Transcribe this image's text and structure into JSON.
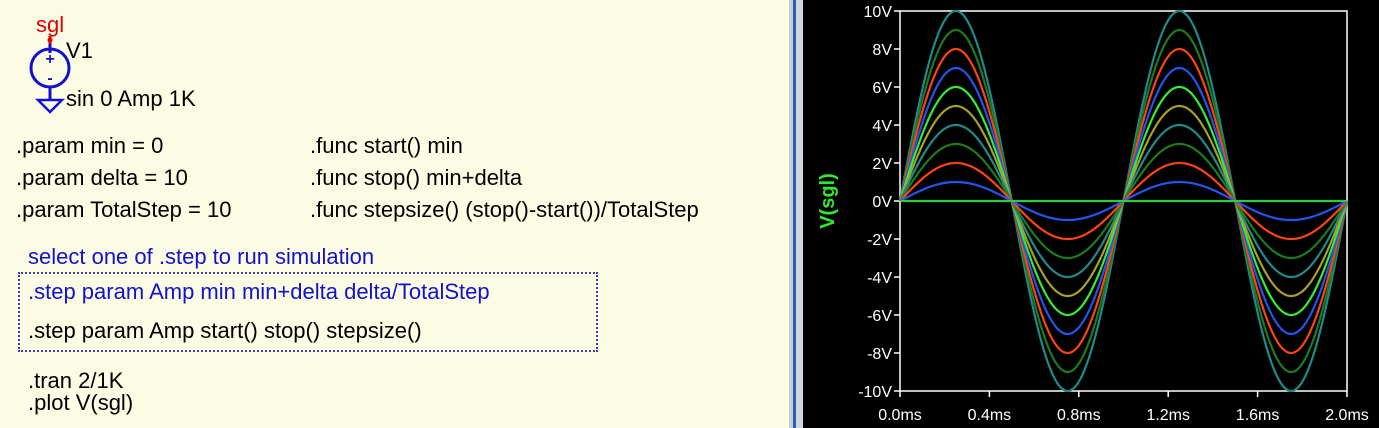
{
  "schematic": {
    "net_label": "sgl",
    "source_name": "V1",
    "source_value": "sin 0 Amp 1K",
    "params": [
      ".param min = 0",
      ".param delta = 10",
      ".param TotalStep = 10"
    ],
    "funcs": [
      ".func start() min",
      ".func stop() min+delta",
      ".func stepsize() (stop()-start())/TotalStep"
    ],
    "select_note": "select one of .step to run simulation",
    "step_options": [
      ".step param Amp min min+delta delta/TotalStep",
      ".step param Amp start() stop() stepsize()"
    ],
    "tran": ".tran 2/1K",
    "plot_cmd": ".plot V(sgl)",
    "colors": {
      "net_label": "#e00000",
      "source": "#1212cc",
      "comment": "#1212cc"
    }
  },
  "chart_data": {
    "type": "line",
    "ylabel": "V(sgl)",
    "x_ticks": [
      "0.0ms",
      "0.4ms",
      "0.8ms",
      "1.2ms",
      "1.6ms",
      "2.0ms"
    ],
    "y_ticks": [
      "10V",
      "8V",
      "6V",
      "4V",
      "2V",
      "0V",
      "-2V",
      "-4V",
      "-6V",
      "-8V",
      "-10V"
    ],
    "xlim": [
      0,
      2.0
    ],
    "ylim": [
      -10,
      10
    ],
    "x_unit": "ms",
    "function": "Amp*sin(2*pi*1000*t)",
    "frequency_hz": 1000,
    "series": [
      {
        "amplitude": 0,
        "color": "#2ecc40"
      },
      {
        "amplitude": 1,
        "color": "#2255ee"
      },
      {
        "amplitude": 2,
        "color": "#ff4411"
      },
      {
        "amplitude": 3,
        "color": "#1e7a1e"
      },
      {
        "amplitude": 4,
        "color": "#1f8a8a"
      },
      {
        "amplitude": 5,
        "color": "#a8a028"
      },
      {
        "amplitude": 6,
        "color": "#33ee33"
      },
      {
        "amplitude": 7,
        "color": "#2255ee"
      },
      {
        "amplitude": 8,
        "color": "#ff4411"
      },
      {
        "amplitude": 9,
        "color": "#1e7a1e"
      },
      {
        "amplitude": 10,
        "color": "#1f8a8a"
      }
    ],
    "background": "#000000",
    "axis_color": "#ffffff",
    "ylabel_color": "#2ee82e"
  }
}
